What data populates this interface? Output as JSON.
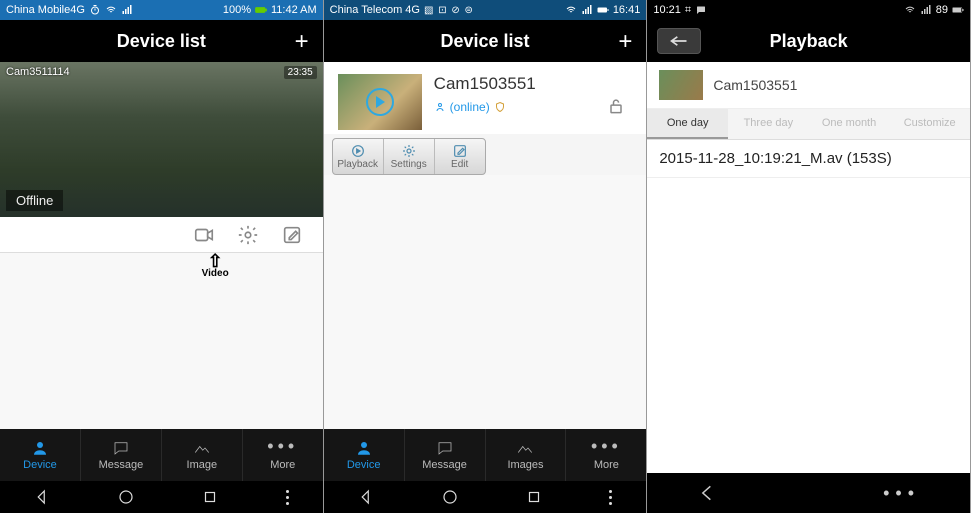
{
  "screen1": {
    "statusbar": {
      "carrier": "China Mobile4G",
      "battery": "100%",
      "time": "11:42 AM"
    },
    "header_title": "Device list",
    "cam_label": "Cam3511114",
    "cam_ts": "23:35",
    "offline_label": "Offline",
    "video_hint_label": "Video",
    "tabs": {
      "device": "Device",
      "message": "Message",
      "image": "Image",
      "more": "More"
    }
  },
  "screen2": {
    "statusbar": {
      "carrier": "China Telecom 4G",
      "time": "16:41"
    },
    "header_title": "Device list",
    "device_name": "Cam1503551",
    "status_text": "(online)",
    "actions": {
      "playback": "Playback",
      "settings": "Settings",
      "edit": "Edit"
    },
    "tabs": {
      "device": "Device",
      "message": "Message",
      "images": "Images",
      "more": "More"
    }
  },
  "screen3": {
    "statusbar": {
      "time": "10:21",
      "battery": "89"
    },
    "header_title": "Playback",
    "device_name": "Cam1503551",
    "filter_tabs": {
      "one_day": "One day",
      "three_day": "Three day",
      "one_month": "One month",
      "customize": "Customize"
    },
    "file_name": "2015-11-28_10:19:21_M.av (153S)"
  }
}
